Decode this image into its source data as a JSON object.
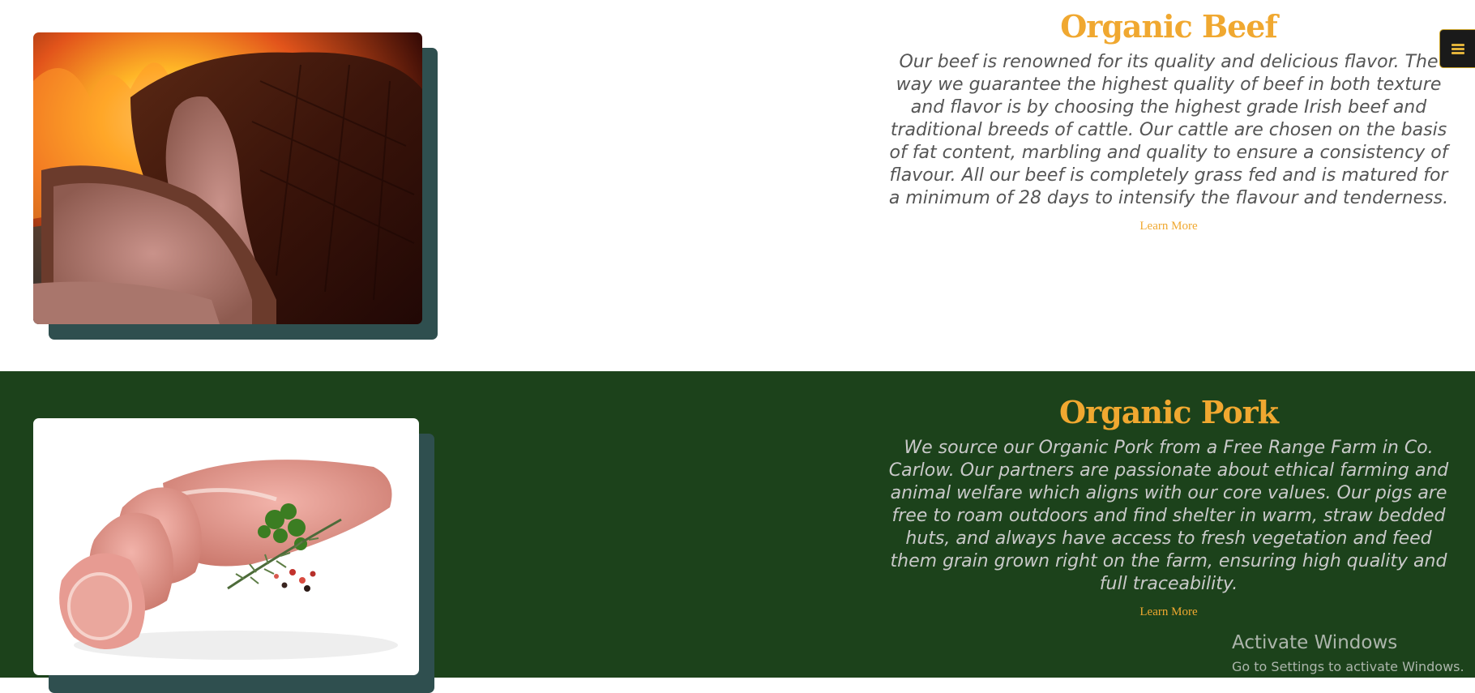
{
  "sections": [
    {
      "title": "Organic Beef",
      "description": "Our beef is renowned for its quality and delicious flavor. The way we guarantee the highest quality of beef in both texture and flavor is by choosing the highest grade Irish beef and traditional breeds of cattle. Our cattle are chosen on the basis of fat content, marbling and quality to ensure a consistency of flavour. All our beef is completely grass fed and is matured for a minimum of 28 days to intensify the flavour and tenderness.",
      "link": "Learn More",
      "image": "roast-beef-photo"
    },
    {
      "title": "Organic Pork",
      "description": "We source our Organic Pork from a Free Range Farm in Co. Carlow. Our partners are passionate about ethical farming and animal welfare which aligns with our core values. Our pigs are free to roam outdoors and find shelter in warm, straw bedded huts, and always have access to fresh vegetation and feed them grain grown right on the farm, ensuring high quality and full traceability.",
      "link": "Learn More",
      "image": "pork-tenderloin-photo"
    }
  ],
  "menu_icon": "hamburger-menu-icon",
  "watermark": {
    "title": "Activate Windows",
    "subtitle": "Go to Settings to activate Windows."
  },
  "colors": {
    "accent": "#f0a830",
    "dark_green": "#1c421b",
    "shadow_slate": "#2f4f4f"
  }
}
